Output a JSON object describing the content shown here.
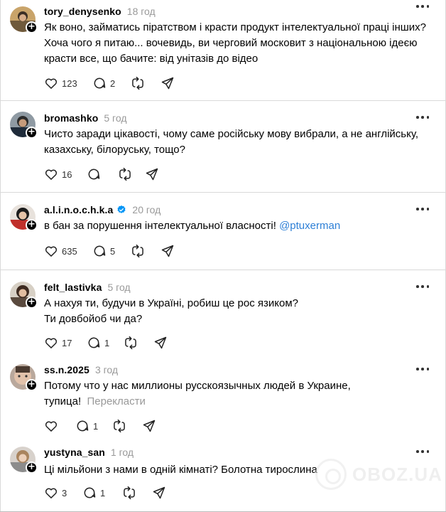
{
  "posts": [
    {
      "username": "tory_denysenko",
      "time": "18 год",
      "verified": false,
      "lines": [
        "Як воно, займатись піратством і красти продукт інтелектуальної праці інших?",
        "Хоча чого я питаю... вочевидь, ви черговий московит з національною ідеєю",
        "красти все, що бачите: від унітазів до відео"
      ],
      "likes": "123",
      "replies": "2"
    },
    {
      "username": "bromashko",
      "time": "5 год",
      "verified": false,
      "lines": [
        "Чисто заради цікавості, чому саме російську мову вибрали, а не англійську,",
        "казахську, білоруську, тощо?"
      ],
      "likes": "16",
      "replies": ""
    },
    {
      "username": "a.l.i.n.o.c.h.k.a",
      "time": "20 год",
      "verified": true,
      "text": "в бан за порушення інтелектуальної власності! ",
      "mention": "@ptuxerman",
      "likes": "635",
      "replies": "5"
    },
    {
      "username": "felt_lastivka",
      "time": "5 год",
      "verified": false,
      "lines": [
        "А нахуя ти, будучи в Україні, робиш це рос язиком?",
        "Ти довбойоб чи да?"
      ],
      "likes": "17",
      "replies": "1"
    },
    {
      "username": "ss.n.2025",
      "time": "3 год",
      "verified": false,
      "line1": "Потому что у нас миллионы русскоязычных людей в Украине,",
      "line2": "тупица!",
      "translate": "Перекласти",
      "likes": "",
      "replies": "1"
    },
    {
      "username": "yustyna_san",
      "time": "1 год",
      "verified": false,
      "lines": [
        "Ці мільйони з нами в одній кімнаті? Болотна тирослина"
      ],
      "likes": "3",
      "replies": "1"
    }
  ],
  "watermark": "OBOZ.UA",
  "icons": {
    "like": "heart-icon",
    "reply": "comment-bubble-icon",
    "repost": "repost-icon",
    "share": "send-icon",
    "more": "more-dots-icon",
    "follow": "plus-icon",
    "verified": "verified-badge-icon"
  },
  "colors": {
    "verified": "#0095f6",
    "mention": "#2d7fd6",
    "muted": "#999999"
  }
}
